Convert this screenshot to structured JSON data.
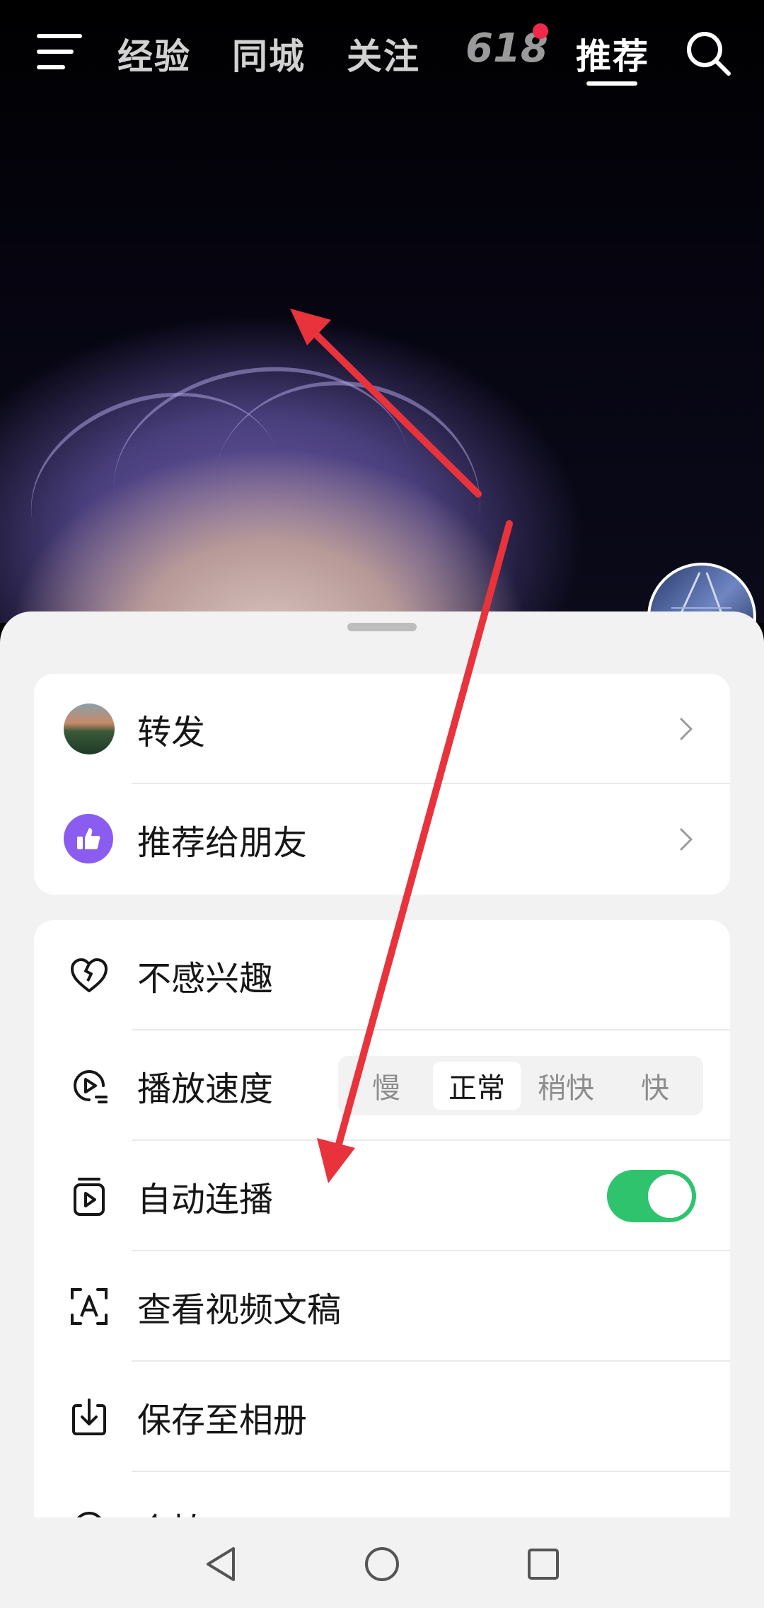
{
  "top_nav": {
    "tabs": [
      {
        "label": "经验"
      },
      {
        "label": "同城"
      },
      {
        "label": "关注"
      },
      {
        "label": "618"
      },
      {
        "label": "推荐"
      }
    ],
    "active_tab": "推荐",
    "badge_color": "#f0284a"
  },
  "sheet": {
    "share_section": [
      {
        "label": "转发",
        "icon": "avatar-thumbnail"
      },
      {
        "label": "推荐给朋友",
        "icon": "thumbs-up-icon"
      }
    ],
    "options": {
      "not_interested": {
        "label": "不感兴趣",
        "icon": "broken-heart-icon"
      },
      "playback_speed": {
        "label": "播放速度",
        "icon": "play-speed-icon",
        "choices": [
          "慢",
          "正常",
          "稍快",
          "快"
        ],
        "selected": "正常"
      },
      "autoplay": {
        "label": "自动连播",
        "icon": "autoplay-icon",
        "enabled": true,
        "toggle_color": "#2fc36e"
      },
      "transcript": {
        "label": "查看视频文稿",
        "icon": "text-recognition-icon"
      },
      "save": {
        "label": "保存至相册",
        "icon": "download-icon"
      },
      "next_partial": {
        "label": "合拍"
      }
    }
  },
  "annotation_color": "#e8333c"
}
